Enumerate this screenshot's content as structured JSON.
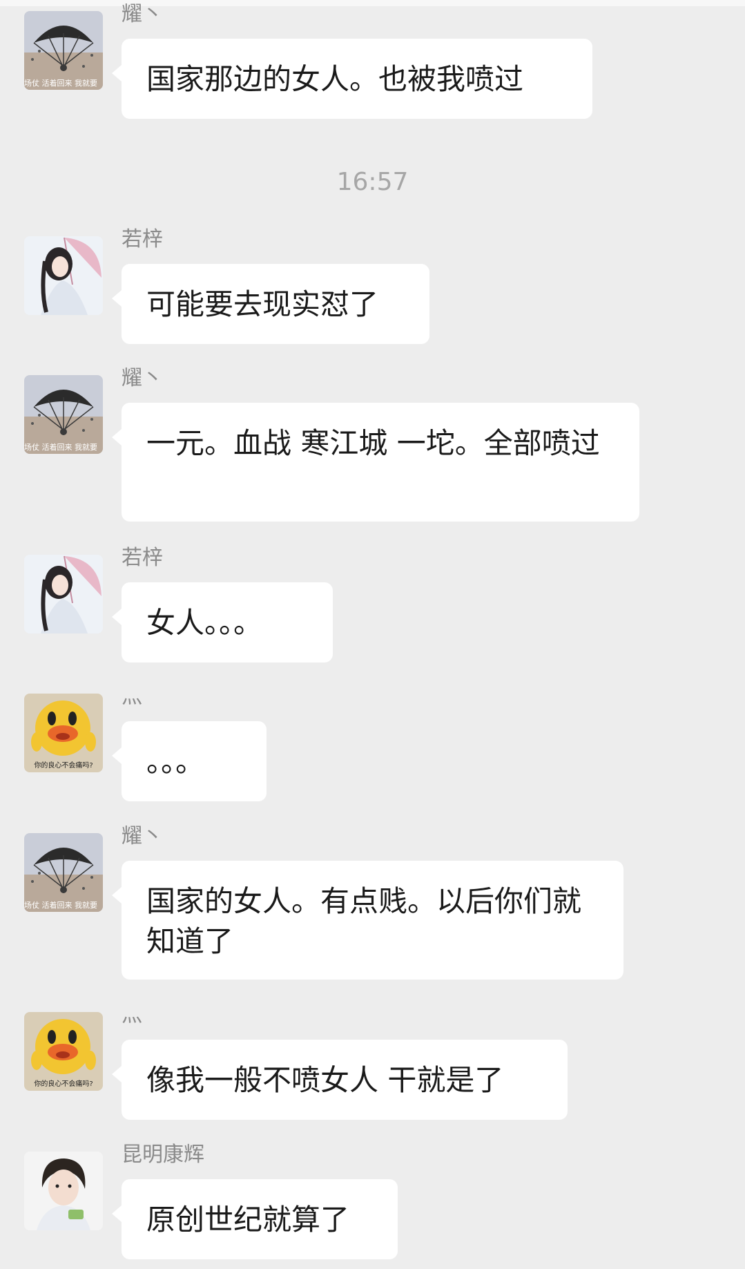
{
  "timestamp": "16:57",
  "colors": {
    "background": "#ededed",
    "bubble": "#ffffff",
    "sender_name": "#8a8a8a",
    "timestamp": "#a6a6a6"
  },
  "messages": [
    {
      "sender": "耀丶",
      "avatar": "parachute-avatar-icon",
      "text": "国家那边的女人。也被我喷过",
      "avatar_caption": "场仗 活着回来 我就要"
    },
    {
      "sender": "若梓",
      "avatar": "umbrella-girl-avatar-icon",
      "text": "可能要去现实怼了"
    },
    {
      "sender": "耀丶",
      "avatar": "parachute-avatar-icon",
      "text": "一元。血战 寒江城 一坨。全部喷过",
      "avatar_caption": "场仗 活着回来 我就要"
    },
    {
      "sender": "若梓",
      "avatar": "umbrella-girl-avatar-icon",
      "text": "女人。。。"
    },
    {
      "sender": "灬",
      "avatar": "yellow-duck-avatar-icon",
      "text": "。。。",
      "avatar_caption": "你的良心不会痛吗?"
    },
    {
      "sender": "耀丶",
      "avatar": "parachute-avatar-icon",
      "text": "国家的女人。有点贱。以后你们就知道了",
      "avatar_caption": "场仗 活着回来 我就要"
    },
    {
      "sender": "灬",
      "avatar": "yellow-duck-avatar-icon",
      "text": "像我一般不喷女人 干就是了",
      "avatar_caption": "你的良心不会痛吗?"
    },
    {
      "sender": "昆明康辉",
      "avatar": "boy-avatar-icon",
      "text": "原创世纪就算了"
    }
  ]
}
